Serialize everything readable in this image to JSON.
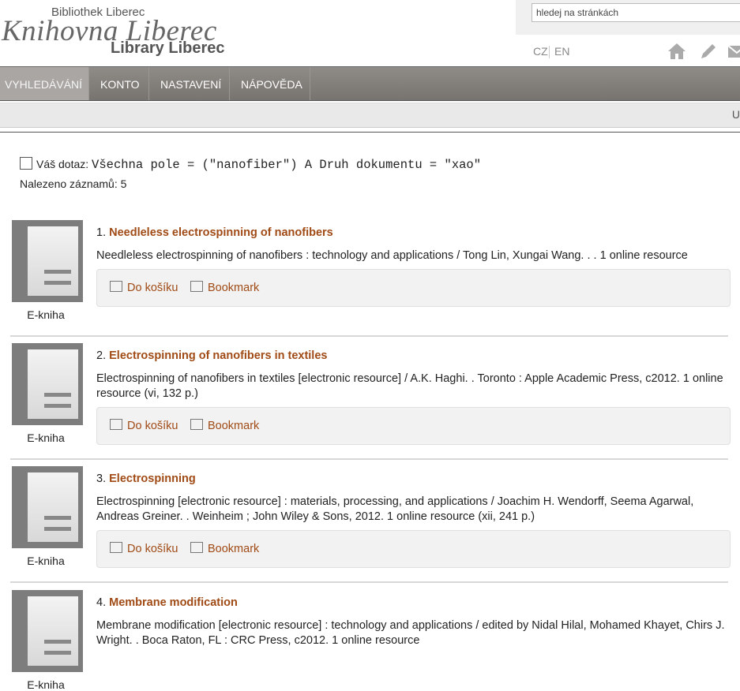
{
  "header": {
    "logo_top": "Bibliothek Liberec",
    "logo_main": "Knihovna Liberec",
    "logo_bottom": "Library Liberec",
    "search_placeholder": "hledej na stránkách",
    "lang_cz": "CZ",
    "lang_en": "EN",
    "icons": [
      "home-icon",
      "pencil-icon",
      "mail-icon"
    ]
  },
  "nav": {
    "items": [
      {
        "label": "VYHLEDÁVÁNÍ"
      },
      {
        "label": "KONTO"
      },
      {
        "label": "NASTAVENÍ"
      },
      {
        "label": "NÁPOVĚDA"
      }
    ]
  },
  "subbar": {
    "edge_text": "U"
  },
  "query": {
    "label": "Váš dotaz:",
    "value": "Všechna pole = (\"nanofiber\") A Druh dokumentu = \"xao\"",
    "count_label": "Nalezeno záznamů: 5"
  },
  "results": [
    {
      "num": "1.",
      "title": "Needleless electrospinning of nanofibers",
      "desc": "Needleless electrospinning of nanofibers : technology and applications / Tong Lin, Xungai Wang. . . 1 online resource",
      "type": "E-kniha",
      "cart": "Do košíku",
      "bookmark": "Bookmark"
    },
    {
      "num": "2.",
      "title": "Electrospinning of nanofibers in textiles",
      "desc": "Electrospinning of nanofibers in textiles [electronic resource] / A.K. Haghi. . Toronto : Apple Academic Press, c2012. 1 online resource (vi, 132 p.)",
      "type": "E-kniha",
      "cart": "Do košíku",
      "bookmark": "Bookmark"
    },
    {
      "num": "3.",
      "title": "Electrospinning",
      "desc": "Electrospinning [electronic resource] : materials, processing, and applications / Joachim H. Wendorff, Seema Agarwal, Andreas Greiner. . Weinheim ; John Wiley & Sons, 2012. 1 online resource (xii, 241 p.)",
      "type": "E-kniha",
      "cart": "Do košíku",
      "bookmark": "Bookmark"
    },
    {
      "num": "4.",
      "title": "Membrane modification",
      "desc": "Membrane modification [electronic resource] : technology and applications / edited by Nidal Hilal, Mohamed Khayet, Chirs J. Wright. . Boca Raton, FL : CRC Press, c2012. 1 online resource",
      "type": "E-kniha",
      "cart": "Do košíku",
      "bookmark": "Bookmark"
    }
  ]
}
